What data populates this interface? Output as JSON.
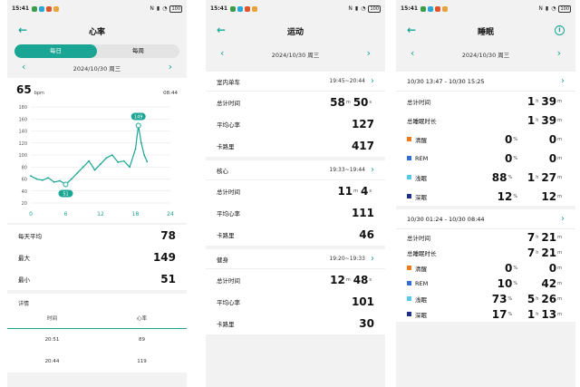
{
  "status": {
    "time": "15:41",
    "battery": "100"
  },
  "heart": {
    "title": "心率",
    "tabs": [
      "每日",
      "每周"
    ],
    "date": "2024/10/30 周三",
    "current_value": "65",
    "current_unit": "bpm",
    "current_time": "08:44",
    "y_ticks": [
      "180",
      "160",
      "140",
      "120",
      "100",
      "80",
      "60",
      "40",
      "20"
    ],
    "x_ticks": [
      "0",
      "6",
      "12",
      "18",
      "24"
    ],
    "max_marker": "149",
    "min_marker": "51",
    "stats": [
      {
        "label": "每天平均",
        "value": "78"
      },
      {
        "label": "最大",
        "value": "149"
      },
      {
        "label": "最小",
        "value": "51"
      }
    ],
    "details_title": "详情",
    "table_headers": [
      "时间",
      "心率"
    ],
    "table_rows": [
      [
        "20:51",
        "89"
      ],
      [
        "20:44",
        "119"
      ]
    ]
  },
  "chart_data": {
    "type": "line",
    "x": [
      0,
      1,
      2,
      3,
      4,
      5,
      6,
      7,
      8,
      9,
      10,
      11,
      12,
      13,
      14,
      15,
      16,
      17,
      18,
      18.5,
      19,
      19.5,
      20
    ],
    "values": [
      65,
      60,
      58,
      62,
      55,
      57,
      51,
      60,
      70,
      80,
      90,
      75,
      85,
      95,
      100,
      88,
      90,
      80,
      110,
      149,
      120,
      100,
      89
    ],
    "xlim": [
      0,
      24
    ],
    "ylim": [
      20,
      180
    ],
    "xticks": [
      0,
      6,
      12,
      18,
      24
    ],
    "yticks": [
      20,
      40,
      60,
      80,
      100,
      120,
      140,
      160,
      180
    ],
    "grid": true
  },
  "exercise": {
    "title": "运动",
    "date": "2024/10/30 周三",
    "labels": {
      "total": "总计时间",
      "avg": "平均心率",
      "cal": "卡路里"
    },
    "sessions": [
      {
        "name": "室内单车",
        "range": "19:45~20:44",
        "minutes": "58",
        "seconds": "50",
        "avg_hr": "127",
        "calories": "417"
      },
      {
        "name": "核心",
        "range": "19:33~19:44",
        "minutes": "11",
        "seconds": "4",
        "avg_hr": "111",
        "calories": "46"
      },
      {
        "name": "健身",
        "range": "19:20~19:33",
        "minutes": "12",
        "seconds": "48",
        "avg_hr": "101",
        "calories": "30"
      }
    ],
    "unit_m": "m",
    "unit_s": "s"
  },
  "sleep": {
    "title": "睡眠",
    "date": "2024/10/30 周三",
    "labels": {
      "total": "总计时间",
      "sleep_total": "总睡眠时长",
      "awake": "清醒",
      "rem": "REM",
      "light": "浅眠",
      "deep": "深眠"
    },
    "colors": {
      "awake": "#f07a1a",
      "rem": "#2f6fd6",
      "light": "#56c8e8",
      "deep": "#1e2f8c"
    },
    "unit_h": "h",
    "unit_m": "m",
    "unit_pct": "%",
    "sessions": [
      {
        "range": "10/30 13:47 - 10/30 15:25",
        "total_h": "1",
        "total_m": "39",
        "sleep_h": "1",
        "sleep_m": "39",
        "awake_pct": "0",
        "awake_m": "0",
        "rem_pct": "0",
        "rem_m": "0",
        "light_pct": "88",
        "light_h": "1",
        "light_m": "27",
        "deep_pct": "12",
        "deep_m": "12"
      },
      {
        "range": "10/30 01:24 - 10/30 08:44",
        "total_h": "7",
        "total_m": "21",
        "sleep_h": "7",
        "sleep_m": "21",
        "awake_pct": "0",
        "awake_m": "0",
        "rem_pct": "10",
        "rem_m": "42",
        "light_pct": "73",
        "light_h": "5",
        "light_m": "26",
        "deep_pct": "17",
        "deep_h": "1",
        "deep_m": "13"
      }
    ]
  }
}
